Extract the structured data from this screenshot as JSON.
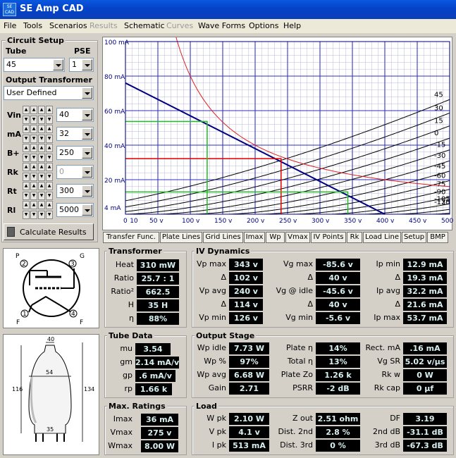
{
  "window": {
    "title": "SE Amp CAD",
    "icon_text": "SE\nCAD"
  },
  "menu": [
    "File",
    "Tools",
    "Scenarios",
    "Results",
    "Schematic",
    "Curves",
    "Wave Forms",
    "Options",
    "Help"
  ],
  "menu_disabled": [
    false,
    false,
    false,
    true,
    false,
    true,
    false,
    false,
    false
  ],
  "circuit": {
    "title": "Circuit Setup",
    "tube_label": "Tube",
    "tube_value": "45",
    "pse_label": "PSE",
    "pse_value": "1",
    "ot_label": "Output Transformer",
    "ot_value": "User Defined",
    "rows": [
      {
        "label": "Vin",
        "value": "40"
      },
      {
        "label": "mA",
        "value": "32"
      },
      {
        "label": "B+",
        "value": "250"
      },
      {
        "label": "Rk",
        "value": "0"
      },
      {
        "label": "Rt",
        "value": "300"
      },
      {
        "label": "Rl",
        "value": "5000"
      }
    ],
    "calc_label": "Calculate Results"
  },
  "tabs": [
    "Transfer Func.",
    "Plate Lines",
    "Grid Lines",
    "Imax",
    "Wp",
    "Vmax",
    "IV Points",
    "Rk",
    "Load Line",
    "Setup",
    "BMP"
  ],
  "chart_data": {
    "type": "line",
    "title": "",
    "xlabel": "",
    "ylabel": "",
    "xlim": [
      0,
      500
    ],
    "ylim": [
      0,
      100
    ],
    "x_ticks": [
      "0",
      "10",
      "50 v",
      "100 v",
      "150 v",
      "200 v",
      "250 v",
      "300 v",
      "350 v",
      "400 v",
      "450 v",
      "500 v"
    ],
    "y_ticks": [
      "100 mA",
      "80 mA",
      "60 mA",
      "40 mA",
      "20 mA",
      "4 mA"
    ],
    "grid_labels": [
      "45",
      "30",
      "15",
      "0",
      "-15",
      "-30",
      "-45",
      "-60",
      "-75",
      "-90",
      "-105",
      "-120",
      "-135"
    ],
    "grid_voltages": [
      45,
      30,
      15,
      0,
      -15,
      -30,
      -45,
      -60,
      -75,
      -90,
      -105,
      -120,
      -135
    ],
    "load_line": [
      [
        0,
        76
      ],
      [
        400,
        0
      ]
    ],
    "operating_point": {
      "v": 240,
      "ma": 32.2
    },
    "swing_points": [
      {
        "v": 126,
        "ma": 53.7
      },
      {
        "v": 343,
        "ma": 12.9
      }
    ],
    "max_dissipation_w": 8,
    "colors": {
      "plate": "#000000",
      "load": "#000080",
      "dissipation": "#e02020",
      "operating": "#e00000",
      "swing": "#20c020",
      "grid": "#3030c0"
    }
  },
  "tube_pins": {
    "p": "P",
    "g": "G",
    "f1": "F",
    "f2": "F",
    "n2": "2",
    "n3": "3",
    "n1": "1",
    "n4": "4"
  },
  "tube_dims": {
    "top": "40",
    "height_left": "116",
    "height_right": "134",
    "width": "54",
    "base": "35"
  },
  "transformer": {
    "title": "Transformer",
    "rows": [
      {
        "label": "Heat",
        "value": "310 mW"
      },
      {
        "label": "Ratio",
        "value": "25.7 : 1"
      },
      {
        "label": "Ratio²",
        "value": "662.5"
      },
      {
        "label": "H",
        "value": "35 H"
      },
      {
        "label": "η",
        "value": "88%"
      }
    ]
  },
  "iv": {
    "title": "IV Dynamics",
    "c1": [
      {
        "label": "Vp max",
        "value": "343 v"
      },
      {
        "label": "Δ",
        "value": "102 v"
      },
      {
        "label": "Vp avg",
        "value": "240 v"
      },
      {
        "label": "Δ",
        "value": "114 v"
      },
      {
        "label": "Vp min",
        "value": "126 v"
      }
    ],
    "c2": [
      {
        "label": "Vg max",
        "value": "-85.6 v"
      },
      {
        "label": "Δ",
        "value": "40 v"
      },
      {
        "label": "Vg @ idle",
        "value": "-45.6 v"
      },
      {
        "label": "Δ",
        "value": "40 v"
      },
      {
        "label": "Vg min",
        "value": "-5.6 v"
      }
    ],
    "c3": [
      {
        "label": "Ip min",
        "value": "12.9 mA"
      },
      {
        "label": "Δ",
        "value": "19.3 mA"
      },
      {
        "label": "Ip avg",
        "value": "32.2 mA"
      },
      {
        "label": "Δ",
        "value": "21.6 mA"
      },
      {
        "label": "Ip max",
        "value": "53.7 mA"
      }
    ]
  },
  "tube_data": {
    "title": "Tube Data",
    "rows": [
      {
        "label": "mu",
        "value": "3.54"
      },
      {
        "label": "gm",
        "value": "2.14 mA/v"
      },
      {
        "label": "gp",
        "value": ".6 mA/v"
      },
      {
        "label": "rp",
        "value": "1.66 k"
      }
    ]
  },
  "output_stage": {
    "title": "Output Stage",
    "c1": [
      {
        "label": "Wp idle",
        "value": "7.73 W"
      },
      {
        "label": "Wp %",
        "value": "97%"
      },
      {
        "label": "Wp avg",
        "value": "6.68 W"
      },
      {
        "label": "Gain",
        "value": "2.71"
      }
    ],
    "c2": [
      {
        "label": "Plate η",
        "value": "14%"
      },
      {
        "label": "Total η",
        "value": "13%"
      },
      {
        "label": "Plate Zo",
        "value": "1.26 k"
      },
      {
        "label": "PSRR",
        "value": "-2 dB"
      }
    ],
    "c3": [
      {
        "label": "Rect. mA",
        "value": ".16 mA"
      },
      {
        "label": "Vg SR",
        "value": "5.02 v/µs"
      },
      {
        "label": "Rk w",
        "value": "0 W"
      },
      {
        "label": "Rk cap",
        "value": "0 µf"
      }
    ]
  },
  "max_ratings": {
    "title": "Max. Ratings",
    "rows": [
      {
        "label": "Imax",
        "value": "36 mA"
      },
      {
        "label": "Vmax",
        "value": "275 v"
      },
      {
        "label": "Wmax",
        "value": "8.00 W"
      }
    ]
  },
  "load": {
    "title": "Load",
    "c1": [
      {
        "label": "W pk",
        "value": "2.10 W"
      },
      {
        "label": "V pk",
        "value": "4.1 v"
      },
      {
        "label": "I pk",
        "value": "513 mA"
      }
    ],
    "c2": [
      {
        "label": "Z out",
        "value": "2.51 ohm"
      },
      {
        "label": "Dist. 2nd",
        "value": "2.8 %"
      },
      {
        "label": "Dist. 3rd",
        "value": "0 %"
      }
    ],
    "c3": [
      {
        "label": "DF",
        "value": "3.19"
      },
      {
        "label": "2nd dB",
        "value": "-31.1 dB"
      },
      {
        "label": "3rd dB",
        "value": "-67.3 dB"
      }
    ]
  }
}
